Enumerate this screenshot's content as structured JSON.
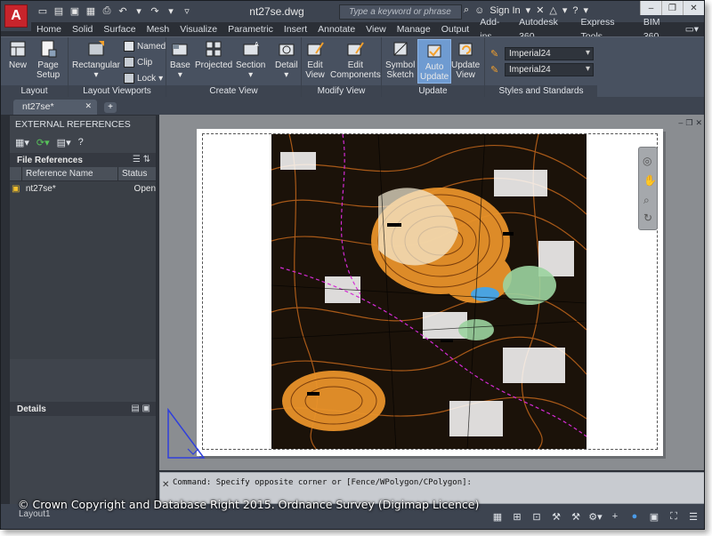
{
  "window": {
    "doc_title": "nt27se.dwg",
    "search_placeholder": "Type a keyword or phrase",
    "sign_in": "Sign In"
  },
  "ribbon_tabs": [
    "Home",
    "Solid",
    "Surface",
    "Mesh",
    "Visualize",
    "Parametric",
    "Insert",
    "Annotate",
    "View",
    "Manage",
    "Output",
    "Add-ins",
    "Autodesk 360",
    "Express Tools",
    "BIM 360"
  ],
  "panels": {
    "layout": {
      "label": "Layout",
      "new": "New",
      "page_setup_1": "Page",
      "page_setup_2": "Setup"
    },
    "layout_viewports": {
      "label": "Layout Viewports",
      "rectangular": "Rectangular",
      "named": "Named",
      "clip": "Clip",
      "lock": "Lock"
    },
    "create_view": {
      "label": "Create View",
      "base": "Base",
      "projected": "Projected",
      "section": "Section",
      "detail": "Detail"
    },
    "modify_view": {
      "label": "Modify View",
      "edit_view_1": "Edit",
      "edit_view_2": "View",
      "edit_components_1": "Edit",
      "edit_components_2": "Components"
    },
    "update": {
      "label": "Update",
      "symbol_sketch_1": "Symbol",
      "symbol_sketch_2": "Sketch",
      "auto_update_1": "Auto",
      "auto_update_2": "Update",
      "update_view_1": "Update",
      "update_view_2": "View"
    },
    "styles": {
      "label": "Styles and Standards",
      "style1": "Imperial24",
      "style2": "Imperial24"
    }
  },
  "doc_tab": {
    "label": "nt27se*"
  },
  "xref_palette": {
    "title": "EXTERNAL REFERENCES",
    "file_references": "File References",
    "col_name": "Reference Name",
    "col_status": "Status",
    "rows": [
      {
        "name": "nt27se*",
        "status": "Open"
      }
    ],
    "details": "Details"
  },
  "command": {
    "text": "Command: Specify opposite corner or [Fence/WPolygon/CPolygon]:"
  },
  "status_bar": {
    "layout_tab": "Layout1"
  },
  "copyright": "© Crown Copyright and Database Right 2015. Ordnance Survey (Digimap Licence)"
}
